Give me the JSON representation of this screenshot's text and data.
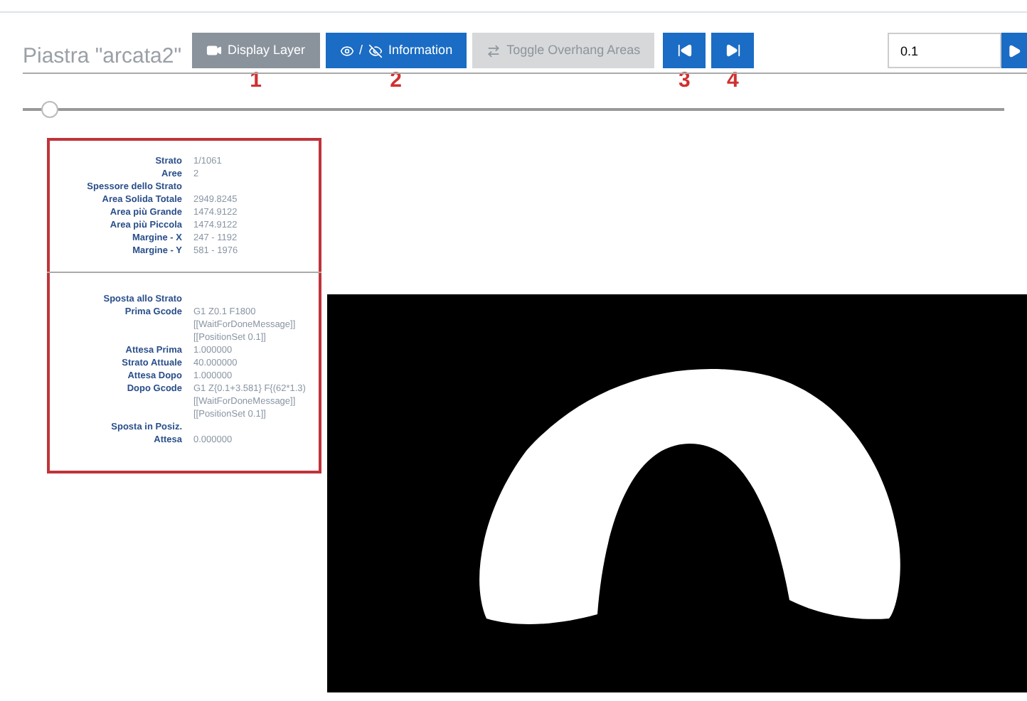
{
  "header": {
    "title": "Piastra \"arcata2\"",
    "buttons": [
      {
        "kind": "camera",
        "label": "Display Layer",
        "disabled": false,
        "marker": "1"
      },
      {
        "kind": "eye",
        "label": "/",
        "label2": "Information",
        "disabled": false,
        "marker": "2"
      },
      {
        "kind": "swap",
        "label": "Toggle Overhang Areas",
        "disabled": true
      },
      {
        "kind": "first",
        "disabled": false,
        "marker": "3"
      },
      {
        "kind": "last",
        "disabled": false,
        "marker": "4"
      }
    ],
    "step_input": {
      "value": "0.1"
    }
  },
  "slider": {
    "level": 0.01
  },
  "info": {
    "sections": [
      {
        "rows": [
          {
            "label": "Strato",
            "value": [
              "1/1061"
            ]
          },
          {
            "label": "Aree",
            "value": [
              "2"
            ]
          },
          {
            "label": "Spessore dello Strato",
            "value": []
          },
          {
            "label": "Area Solida Totale",
            "value": [
              "2949.8245"
            ]
          },
          {
            "label": "Area più Grande",
            "value": [
              "1474.9122"
            ]
          },
          {
            "label": "Area più Piccola",
            "value": [
              "1474.9122"
            ]
          },
          {
            "label": "Margine - X",
            "value": [
              "247 - 1192"
            ]
          },
          {
            "label": "Margine - Y",
            "value": [
              "581 - 1976"
            ]
          }
        ]
      },
      {
        "rows": [
          {
            "label": "Sposta allo Strato",
            "value": []
          },
          {
            "label": "Prima Gcode",
            "value": [
              "G1 Z0.1 F1800",
              "[[WaitForDoneMessage]]",
              "[[PositionSet 0.1]]"
            ]
          },
          {
            "label": "Attesa Prima",
            "value": [
              "1.000000"
            ]
          },
          {
            "label": "Strato Attuale",
            "value": [
              "40.000000"
            ]
          },
          {
            "label": "Attesa Dopo",
            "value": [
              "1.000000"
            ]
          },
          {
            "label": "Dopo Gcode",
            "value": [
              "G1 Z{0.1+3.581} F{(62*1.3)",
              "[[WaitForDoneMessage]]",
              "[[PositionSet 0.1]]"
            ]
          },
          {
            "label": "Sposta in Posiz.",
            "value": []
          },
          {
            "label": "Attesa",
            "value": [
              "0.000000"
            ]
          }
        ]
      }
    ]
  }
}
